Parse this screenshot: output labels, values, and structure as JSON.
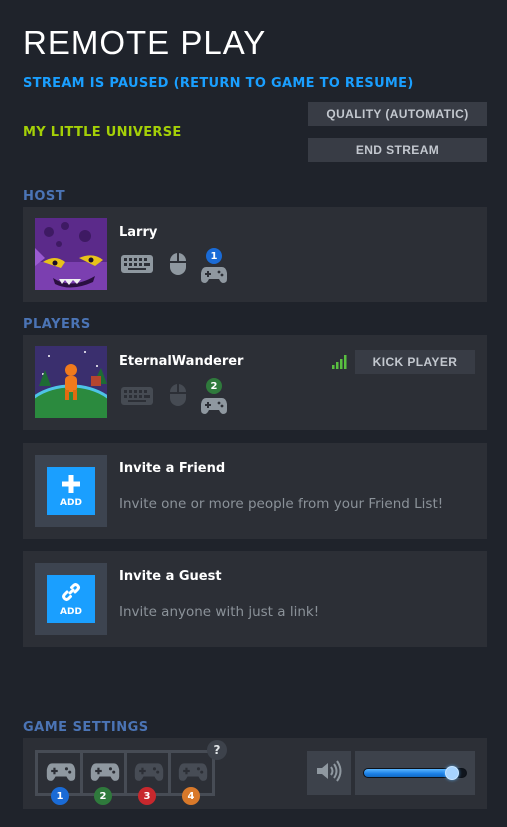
{
  "header": {
    "title": "REMOTE PLAY",
    "status": "STREAM IS PAUSED (RETURN TO GAME TO RESUME)",
    "game_name": "MY LITTLE UNIVERSE",
    "quality_label": "QUALITY (AUTOMATIC)",
    "end_stream_label": "END STREAM"
  },
  "host": {
    "section_label": "HOST",
    "name": "Larry",
    "controller_slot": "1",
    "devices": [
      "keyboard-icon",
      "mouse-icon",
      "gamepad-icon"
    ]
  },
  "players": {
    "section_label": "PLAYERS",
    "list": [
      {
        "name": "EternalWanderer",
        "controller_slot": "2",
        "kick_label": "KICK PLAYER",
        "signal_bars": 4
      }
    ]
  },
  "invites": {
    "friend": {
      "add_label": "ADD",
      "title": "Invite a Friend",
      "description": "Invite one or more people from your Friend List!"
    },
    "guest": {
      "add_label": "ADD",
      "title": "Invite a Guest",
      "description": "Invite anyone with just a link!"
    }
  },
  "game_settings": {
    "section_label": "GAME SETTINGS",
    "help_label": "?",
    "slots": [
      {
        "number": "1",
        "color": "#1a6bd6",
        "active": true
      },
      {
        "number": "2",
        "color": "#2f7a3c",
        "active": true
      },
      {
        "number": "3",
        "color": "#c8282d",
        "active": false
      },
      {
        "number": "4",
        "color": "#d9792a",
        "active": false
      }
    ],
    "volume": 0.92
  },
  "colors": {
    "accent_blue": "#1a9fff",
    "game_green": "#a4d007",
    "section_blue": "#4b74b5",
    "background": "#1f232b",
    "panel": "#2c2f36"
  }
}
